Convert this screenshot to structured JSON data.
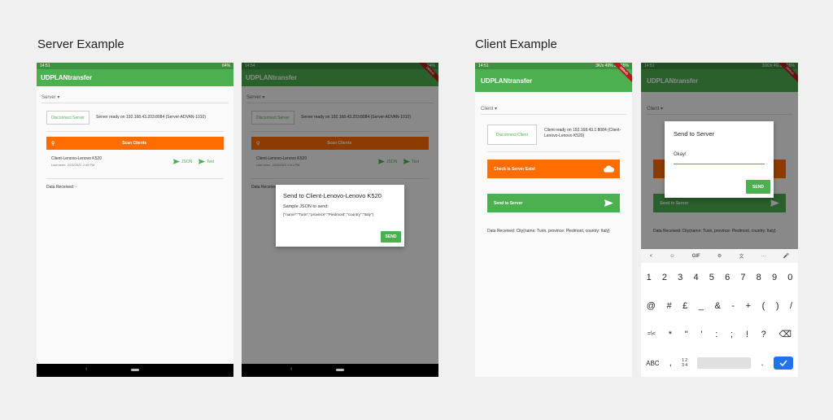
{
  "sections": {
    "server_title": "Server Example",
    "client_title": "Client Example"
  },
  "colors": {
    "green": "#4caf50",
    "orange": "#ff6d00",
    "debug": "#b71c1c"
  },
  "app_title": "UDPLANtransfer",
  "debug_banner": "DEBUG",
  "server1": {
    "status_time": "14:51",
    "status_right": "64%",
    "dropdown": "Server",
    "disconnect_label": "Disconnect Server",
    "server_info": "Server ready on 192.168.43.203:8084 (Server-ADVAN-1010)",
    "scan_label": "Scan Clients",
    "client_name": "Client-Lenovo-Lenovo K520",
    "last_seen": "Last seen: 2/23/2021 2:49 PM",
    "json_label": "JSON",
    "text_label": "Text",
    "data_received": "Data Received: -"
  },
  "server2": {
    "status_time": "14:54",
    "status_right": "64%",
    "dropdown": "Server",
    "disconnect_label": "Disconnect Server",
    "server_info": "Server ready on 192.168.43.203:8084 (Server-ADVAN-1010)",
    "scan_label": "Scan Clients",
    "client_name": "Client-Lenovo-Lenovo K520",
    "last_seen": "Last seen: 2/23/2021 2:51 PM",
    "json_label": "JSON",
    "text_label": "Text",
    "data_received": "Data Received: -",
    "dialog": {
      "title": "Send to Client-Lenovo-Lenovo K520",
      "body_line1": "Sample JSON to send:",
      "body_line2": "{\"name\":\"Turin\",\"province\":\"Piedmont\",\"country\":\"Italy\"}",
      "send_label": "SEND"
    }
  },
  "client1": {
    "status_time": "14:51",
    "status_right": "3K/s  49%  3G  55%",
    "dropdown": "Client",
    "disconnect_label": "Disconnect Client",
    "client_info": "Client ready on 192.168.43.1:8084 (Client-Lenovo-Lenovo K520)",
    "check_label": "Check is Server Exist",
    "send_label": "Send to Server",
    "data_received": "Data Received: City{name: Turin, province: Piedmont, country: Italy}"
  },
  "client2": {
    "status_time": "14:51",
    "status_right": "31K/s  4G  3G  55%",
    "dropdown": "Client",
    "send_label": "Send to Server",
    "data_received": "Data Received: City{name: Turin, province: Piedmont, country: Italy}",
    "dialog": {
      "title": "Send to Server",
      "input_value": "Okay!",
      "send_label": "SEND"
    },
    "keyboard": {
      "toolbar": [
        "<",
        "☺",
        "GIF",
        "⚙",
        "文",
        "···",
        "🎤"
      ],
      "row1": [
        "1",
        "2",
        "3",
        "4",
        "5",
        "6",
        "7",
        "8",
        "9",
        "0"
      ],
      "row2": [
        "@",
        "#",
        "£",
        "_",
        "&",
        "-",
        "+",
        "(",
        ")",
        "/"
      ],
      "row3": [
        "=\\<",
        "*",
        "\"",
        "'",
        ":",
        ";",
        "!",
        "?",
        "⌫"
      ],
      "row4": [
        "ABC",
        ",",
        "1 2\n3 4",
        "",
        "."
      ]
    }
  }
}
